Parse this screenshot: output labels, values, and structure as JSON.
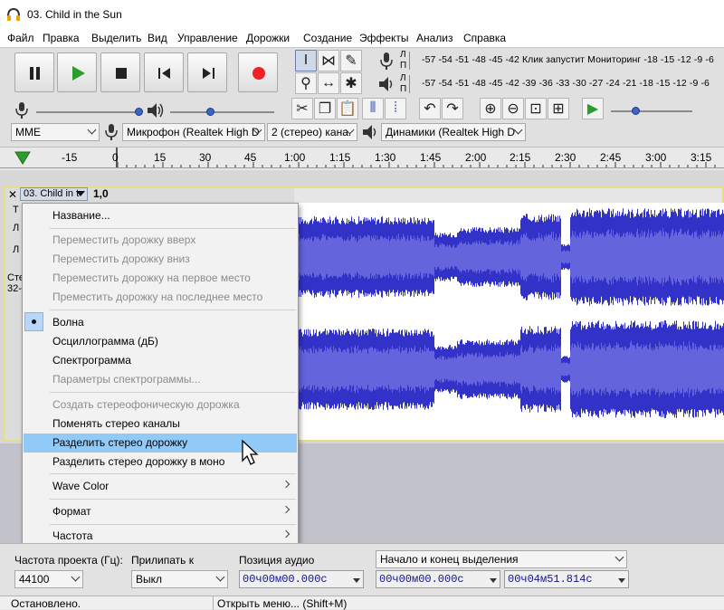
{
  "window": {
    "title": "03. Child in the Sun"
  },
  "menu": [
    "Файл",
    "Правка",
    "Выделить",
    "Вид",
    "Управление",
    "Дорожки",
    "Создание",
    "Эффекты",
    "Анализ",
    "Справка"
  ],
  "meters": {
    "rec_l": "Л",
    "rec_r": "П",
    "play_l": "Л",
    "play_r": "П",
    "rec_ticks": "-57 -54 -51 -48 -45 -42  Клик запустит  Мониторинг  -18 -15 -12  -9  -6",
    "play_ticks": "-57 -54 -51 -48 -45 -42 -39 -36 -33 -30 -27 -24 -21 -18 -15 -12  -9  -6"
  },
  "devices": {
    "host": "MME",
    "mic": "Микрофон (Realtek High D",
    "channels": "2 (стерео) кана.",
    "speakers": "Динамики (Realtek High D"
  },
  "timeline": {
    "labels": [
      "-15",
      "0",
      "15",
      "30",
      "45",
      "1:00",
      "1:15",
      "1:30",
      "1:45",
      "2:00",
      "2:15",
      "2:30",
      "2:45",
      "3:00",
      "3:15"
    ]
  },
  "track": {
    "name": "03. Child in t",
    "gain": "1,0",
    "side_t": "Т",
    "side_l1": "Л",
    "side_l2": "Л",
    "side_stereo": "Сте",
    "side_bits": "32-"
  },
  "context_menu": {
    "items": [
      {
        "label": "Название...",
        "enabled": true
      },
      {
        "label": "Переместить дорожку вверх",
        "enabled": false
      },
      {
        "label": "Переместить дорожку вниз",
        "enabled": false
      },
      {
        "label": "Переместить дорожку на первое место",
        "enabled": false
      },
      {
        "label": "Преместить дорожку на последнее место",
        "enabled": false
      },
      {
        "label": "Волна",
        "enabled": true,
        "checked": true
      },
      {
        "label": "Осциллограмма (дБ)",
        "enabled": true
      },
      {
        "label": "Спектрограмма",
        "enabled": true
      },
      {
        "label": "Параметры спектрограммы...",
        "enabled": false
      },
      {
        "label": "Создать стереофоническую дорожка",
        "enabled": false
      },
      {
        "label": "Поменять стерео каналы",
        "enabled": true
      },
      {
        "label": "Разделить стерео дорожку",
        "enabled": true,
        "highlighted": true
      },
      {
        "label": "Разделить стерео дорожку в моно",
        "enabled": true
      },
      {
        "label": "Wave Color",
        "enabled": true,
        "submenu": true
      },
      {
        "label": "Формат",
        "enabled": true,
        "submenu": true
      },
      {
        "label": "Частота",
        "enabled": true,
        "submenu": true
      }
    ]
  },
  "selection_bar": {
    "rate_label": "Частота проекта (Гц):",
    "rate_value": "44100",
    "snap_label": "Прилипать к",
    "snap_value": "Выкл",
    "audio_pos_label": "Позиция аудио",
    "audio_pos_value": "00ч00м00.000с",
    "sel_mode": "Начало и конец выделения",
    "sel_start": "00ч00м00.000с",
    "sel_end": "00ч04м51.814с"
  },
  "status": {
    "left": "Остановлено.",
    "right": "Открыть меню... (Shift+M)"
  },
  "colors": {
    "wave": "#3232c8",
    "wave_rms": "#6464dc",
    "menu_highlight": "#91c9f7",
    "track_border": "#e4df83"
  }
}
